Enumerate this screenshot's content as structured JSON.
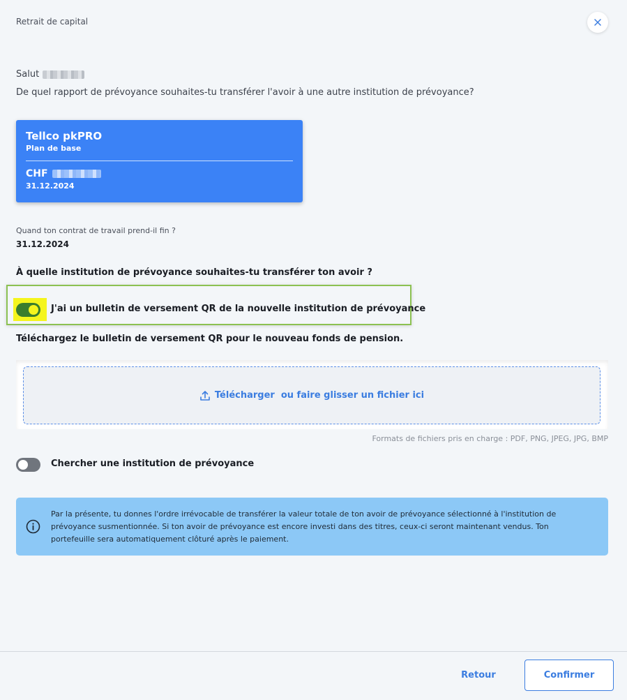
{
  "header": {
    "title": "Retrait de capital",
    "close_icon": "close-icon"
  },
  "greeting": {
    "salutation": "Salut"
  },
  "question_main": "De quel rapport de prévoyance souhaites-tu transférer l'avoir à une autre institution de prévoyance?",
  "plan_card": {
    "name": "Tellco pkPRO",
    "plan": "Plan de base",
    "currency": "CHF",
    "date": "31.12.2024",
    "color": "#3b82f6"
  },
  "contract": {
    "label": "Quand ton contrat de travail prend-il fin ?",
    "value": "31.12.2024"
  },
  "institution_question": "À quelle institution de prévoyance souhaites-tu transférer ton avoir ?",
  "qr_toggle": {
    "label": "J'ai un bulletin de versement QR de la nouvelle institution de prévoyance",
    "checked": true
  },
  "upload": {
    "instruction": "Téléchargez le bulletin de versement QR pour le nouveau fonds de pension.",
    "link_label": "Télécharger",
    "rest_label": "ou faire glisser un fichier ici",
    "icon": "upload-icon",
    "formats": "Formats de fichiers pris en charge : PDF, PNG, JPEG, JPG, BMP"
  },
  "search_toggle": {
    "label": "Chercher une institution de prévoyance",
    "checked": false
  },
  "info": {
    "icon": "info-icon",
    "text": "Par la présente, tu donnes l'ordre irrévocable de transférer la valeur totale de ton avoir de prévoyance sélectionné à l'institution de prévoyance susmentionnée. Si ton avoir de prévoyance est encore investi dans des titres, ceux-ci seront maintenant vendus. Ton portefeuille sera automatiquement clôturé après le paiement."
  },
  "footer": {
    "back_label": "Retour",
    "confirm_label": "Confirmer"
  }
}
